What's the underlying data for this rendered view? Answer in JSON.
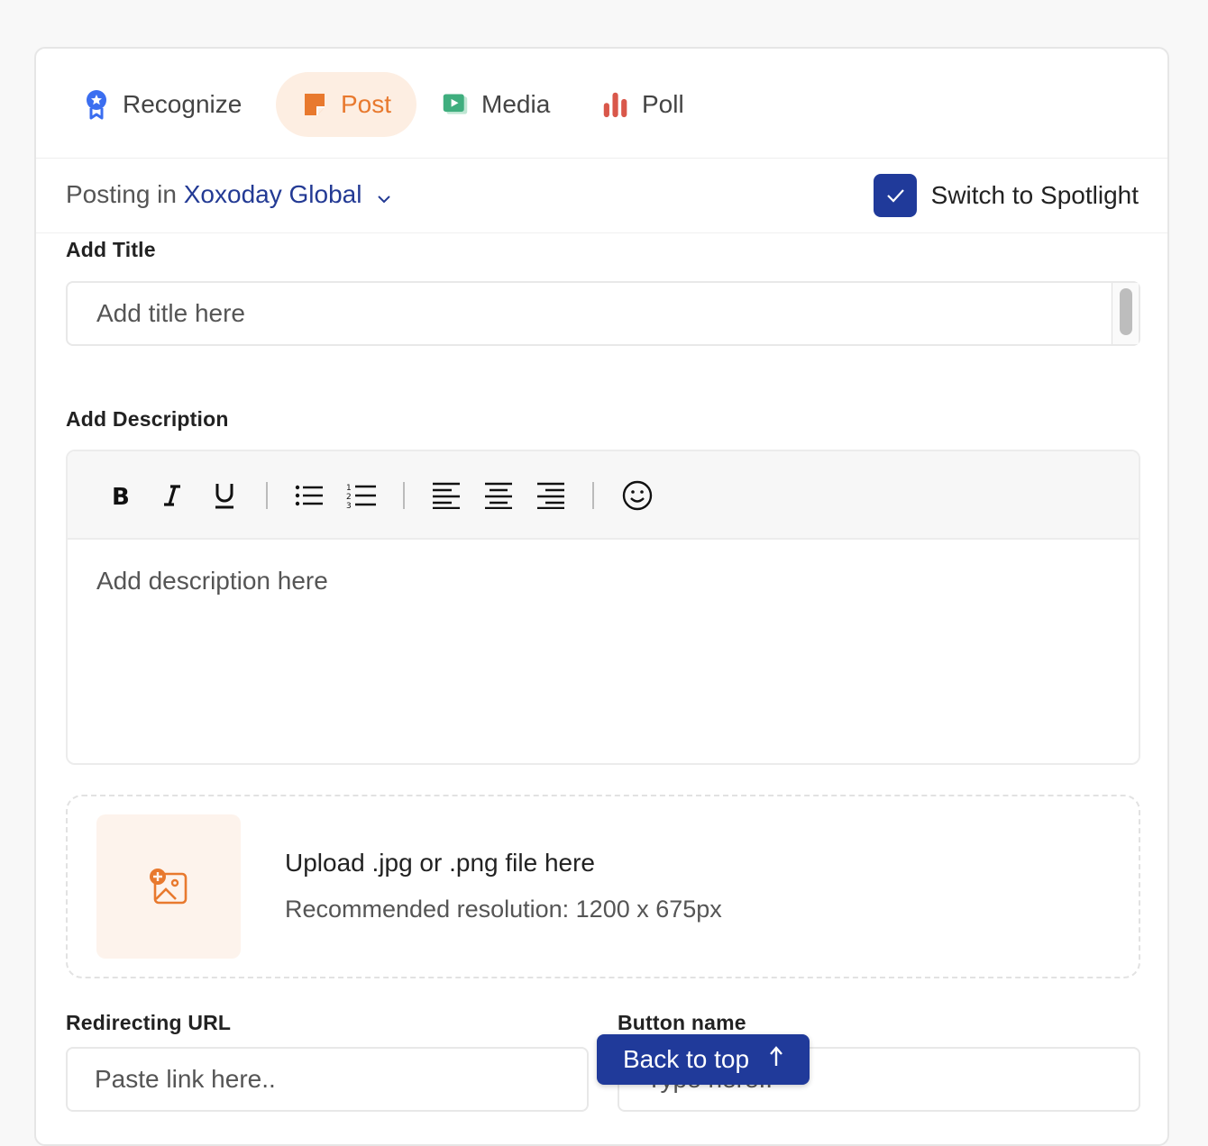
{
  "tabs": [
    {
      "label": "Recognize",
      "icon": "ribbon-award-icon"
    },
    {
      "label": "Post",
      "icon": "sticky-note-icon",
      "active": true
    },
    {
      "label": "Media",
      "icon": "play-video-icon"
    },
    {
      "label": "Poll",
      "icon": "bar-chart-icon"
    }
  ],
  "posting": {
    "prefix": "Posting in",
    "group": "Xoxoday Global",
    "spotlight_label": "Switch to Spotlight",
    "spotlight_checked": true
  },
  "title_field": {
    "label": "Add Title",
    "placeholder": "Add title here"
  },
  "description_field": {
    "label": "Add Description",
    "placeholder": "Add description here",
    "toolbar": [
      "bold",
      "italic",
      "underline",
      "bullet-list",
      "numbered-list",
      "align-left",
      "align-center",
      "align-right",
      "emoji"
    ]
  },
  "upload": {
    "title": "Upload .jpg or .png file here",
    "subtitle": "Recommended resolution: 1200 x 675px"
  },
  "redirect": {
    "label": "Redirecting URL",
    "placeholder": "Paste link here.."
  },
  "button_name": {
    "label": "Button name",
    "placeholder": "Type here.."
  },
  "back_to_top": {
    "label": "Back to top"
  },
  "colors": {
    "accent_blue": "#203a9a",
    "post_orange": "#e8792e",
    "post_bg": "#fdeee2",
    "media_green": "#3fae7e",
    "poll_red": "#d9574a"
  }
}
